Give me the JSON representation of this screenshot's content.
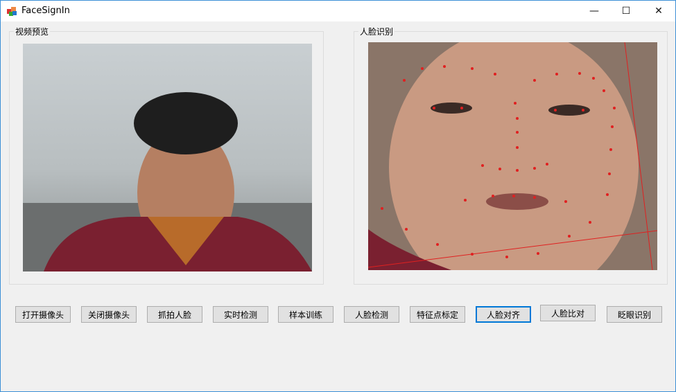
{
  "window": {
    "title": "FaceSignIn",
    "minimize": "—",
    "maximize": "☐",
    "close": "✕"
  },
  "groups": {
    "preview": "视频预览",
    "recognition": "人脸识别"
  },
  "buttons": [
    "打开摄像头",
    "关闭摄像头",
    "抓拍人脸",
    "实时检测",
    "样本训练",
    "人脸检测",
    "特征点标定",
    "人脸对齐",
    "人脸比对",
    "眨眼识别"
  ]
}
